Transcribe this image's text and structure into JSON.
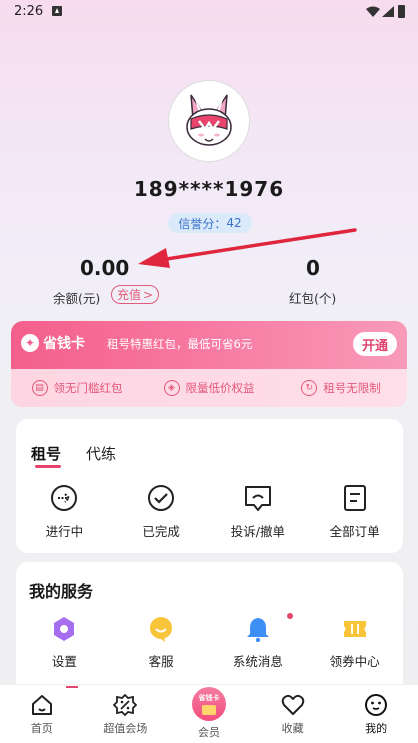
{
  "status_bar": {
    "time": "2:26"
  },
  "profile": {
    "phone": "189****1976",
    "credit_label": "信誉分",
    "credit_value": "42"
  },
  "wallet": {
    "balance_value": "0.00",
    "balance_label": "余额(元)",
    "recharge_label": "充值",
    "recharge_chevron": ">",
    "redpacket_value": "0",
    "redpacket_label": "红包(个)"
  },
  "vip_card": {
    "title": "省钱卡",
    "description": "租号特惠红包，最低可省6元",
    "open_button": "开通",
    "benefits": [
      "领无门槛红包",
      "限量低价权益",
      "租号无限制"
    ]
  },
  "orders": {
    "tabs": [
      "租号",
      "代练"
    ],
    "items": [
      "进行中",
      "已完成",
      "投诉/撤单",
      "全部订单"
    ]
  },
  "services": {
    "title": "我的服务",
    "items": [
      "设置",
      "客服",
      "系统消息",
      "领券中心"
    ]
  },
  "bottom_nav": {
    "items": [
      "首页",
      "超值会场",
      "会员",
      "收藏",
      "我的"
    ],
    "vip_badge_text": "省钱卡",
    "active": "我的"
  },
  "colors": {
    "accent": "#e8446d",
    "vip_gradient_start": "#f45f8b",
    "credit_text": "#3a70c8"
  }
}
